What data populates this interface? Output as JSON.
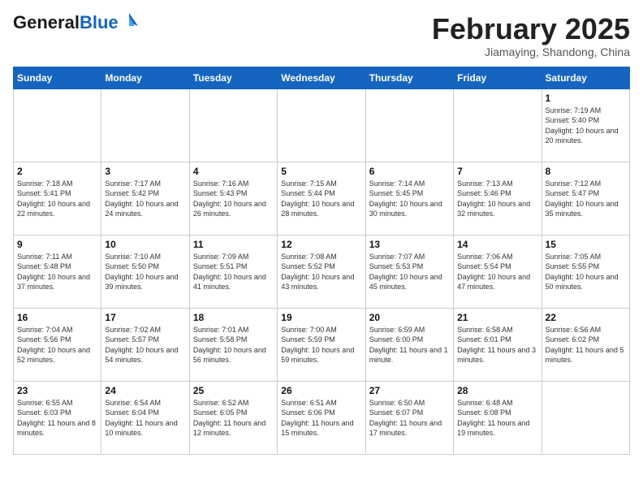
{
  "header": {
    "logo_line1": "General",
    "logo_line2": "Blue",
    "month": "February 2025",
    "location": "Jiamaying, Shandong, China"
  },
  "weekdays": [
    "Sunday",
    "Monday",
    "Tuesday",
    "Wednesday",
    "Thursday",
    "Friday",
    "Saturday"
  ],
  "weeks": [
    [
      {
        "day": "",
        "info": ""
      },
      {
        "day": "",
        "info": ""
      },
      {
        "day": "",
        "info": ""
      },
      {
        "day": "",
        "info": ""
      },
      {
        "day": "",
        "info": ""
      },
      {
        "day": "",
        "info": ""
      },
      {
        "day": "1",
        "info": "Sunrise: 7:19 AM\nSunset: 5:40 PM\nDaylight: 10 hours and 20 minutes."
      }
    ],
    [
      {
        "day": "2",
        "info": "Sunrise: 7:18 AM\nSunset: 5:41 PM\nDaylight: 10 hours and 22 minutes."
      },
      {
        "day": "3",
        "info": "Sunrise: 7:17 AM\nSunset: 5:42 PM\nDaylight: 10 hours and 24 minutes."
      },
      {
        "day": "4",
        "info": "Sunrise: 7:16 AM\nSunset: 5:43 PM\nDaylight: 10 hours and 26 minutes."
      },
      {
        "day": "5",
        "info": "Sunrise: 7:15 AM\nSunset: 5:44 PM\nDaylight: 10 hours and 28 minutes."
      },
      {
        "day": "6",
        "info": "Sunrise: 7:14 AM\nSunset: 5:45 PM\nDaylight: 10 hours and 30 minutes."
      },
      {
        "day": "7",
        "info": "Sunrise: 7:13 AM\nSunset: 5:46 PM\nDaylight: 10 hours and 32 minutes."
      },
      {
        "day": "8",
        "info": "Sunrise: 7:12 AM\nSunset: 5:47 PM\nDaylight: 10 hours and 35 minutes."
      }
    ],
    [
      {
        "day": "9",
        "info": "Sunrise: 7:11 AM\nSunset: 5:48 PM\nDaylight: 10 hours and 37 minutes."
      },
      {
        "day": "10",
        "info": "Sunrise: 7:10 AM\nSunset: 5:50 PM\nDaylight: 10 hours and 39 minutes."
      },
      {
        "day": "11",
        "info": "Sunrise: 7:09 AM\nSunset: 5:51 PM\nDaylight: 10 hours and 41 minutes."
      },
      {
        "day": "12",
        "info": "Sunrise: 7:08 AM\nSunset: 5:52 PM\nDaylight: 10 hours and 43 minutes."
      },
      {
        "day": "13",
        "info": "Sunrise: 7:07 AM\nSunset: 5:53 PM\nDaylight: 10 hours and 45 minutes."
      },
      {
        "day": "14",
        "info": "Sunrise: 7:06 AM\nSunset: 5:54 PM\nDaylight: 10 hours and 47 minutes."
      },
      {
        "day": "15",
        "info": "Sunrise: 7:05 AM\nSunset: 5:55 PM\nDaylight: 10 hours and 50 minutes."
      }
    ],
    [
      {
        "day": "16",
        "info": "Sunrise: 7:04 AM\nSunset: 5:56 PM\nDaylight: 10 hours and 52 minutes."
      },
      {
        "day": "17",
        "info": "Sunrise: 7:02 AM\nSunset: 5:57 PM\nDaylight: 10 hours and 54 minutes."
      },
      {
        "day": "18",
        "info": "Sunrise: 7:01 AM\nSunset: 5:58 PM\nDaylight: 10 hours and 56 minutes."
      },
      {
        "day": "19",
        "info": "Sunrise: 7:00 AM\nSunset: 5:59 PM\nDaylight: 10 hours and 59 minutes."
      },
      {
        "day": "20",
        "info": "Sunrise: 6:59 AM\nSunset: 6:00 PM\nDaylight: 11 hours and 1 minute."
      },
      {
        "day": "21",
        "info": "Sunrise: 6:58 AM\nSunset: 6:01 PM\nDaylight: 11 hours and 3 minutes."
      },
      {
        "day": "22",
        "info": "Sunrise: 6:56 AM\nSunset: 6:02 PM\nDaylight: 11 hours and 5 minutes."
      }
    ],
    [
      {
        "day": "23",
        "info": "Sunrise: 6:55 AM\nSunset: 6:03 PM\nDaylight: 11 hours and 8 minutes."
      },
      {
        "day": "24",
        "info": "Sunrise: 6:54 AM\nSunset: 6:04 PM\nDaylight: 11 hours and 10 minutes."
      },
      {
        "day": "25",
        "info": "Sunrise: 6:52 AM\nSunset: 6:05 PM\nDaylight: 11 hours and 12 minutes."
      },
      {
        "day": "26",
        "info": "Sunrise: 6:51 AM\nSunset: 6:06 PM\nDaylight: 11 hours and 15 minutes."
      },
      {
        "day": "27",
        "info": "Sunrise: 6:50 AM\nSunset: 6:07 PM\nDaylight: 11 hours and 17 minutes."
      },
      {
        "day": "28",
        "info": "Sunrise: 6:48 AM\nSunset: 6:08 PM\nDaylight: 11 hours and 19 minutes."
      },
      {
        "day": "",
        "info": ""
      }
    ]
  ]
}
